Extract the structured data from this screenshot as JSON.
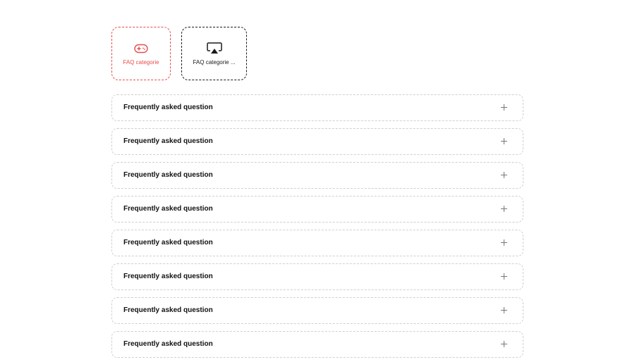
{
  "categories": [
    {
      "label": "FAQ categorie",
      "icon": "gamepad-icon",
      "active": true
    },
    {
      "label": "FAQ categorie ...",
      "icon": "airplay-icon",
      "active": false
    }
  ],
  "faqs": [
    {
      "question": "Frequently asked question"
    },
    {
      "question": "Frequently asked question"
    },
    {
      "question": "Frequently asked question"
    },
    {
      "question": "Frequently asked question"
    },
    {
      "question": "Frequently asked question"
    },
    {
      "question": "Frequently asked question"
    },
    {
      "question": "Frequently asked question"
    },
    {
      "question": "Frequently asked question"
    }
  ],
  "colors": {
    "accent": "#e84c4c",
    "text": "#111111",
    "border": "#cfcfcf"
  }
}
